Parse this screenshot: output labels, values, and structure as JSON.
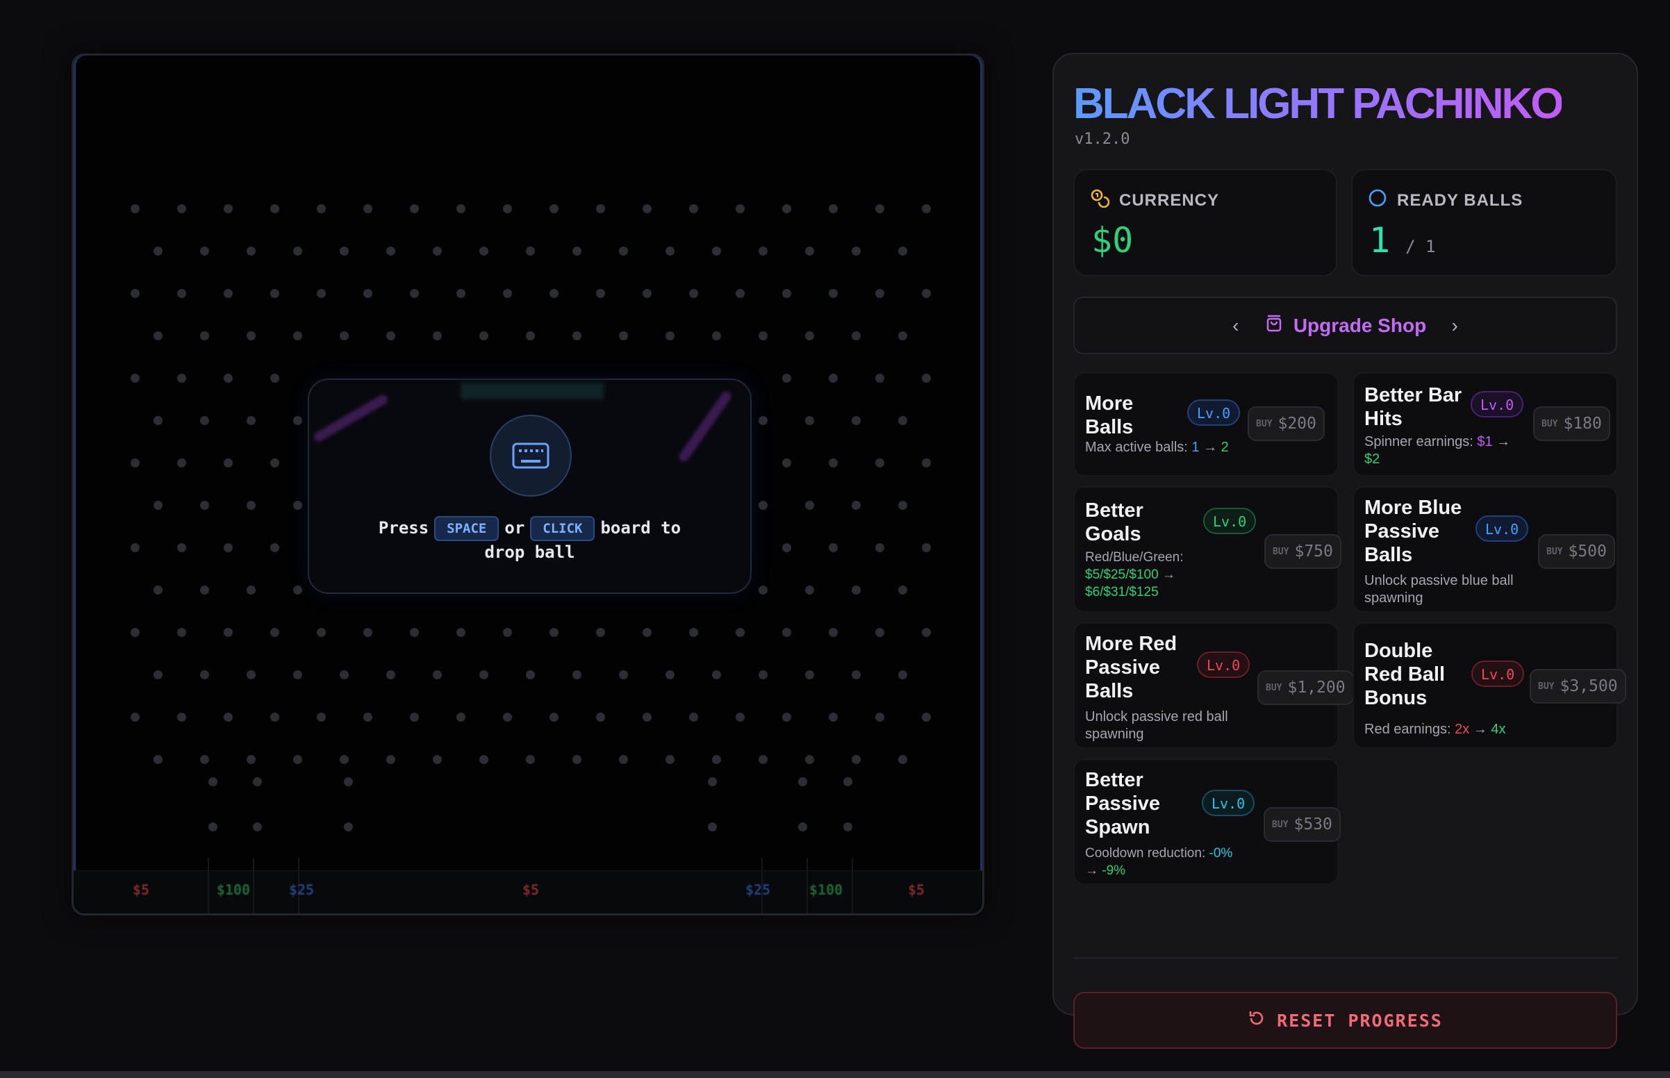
{
  "board": {
    "slots": [
      {
        "label": "$5",
        "color": "#e0444d"
      },
      {
        "label": "$100",
        "color": "#2fb35a"
      },
      {
        "label": "$25",
        "color": "#3a6fd8"
      },
      {
        "label": "$5",
        "color": "#e0444d"
      },
      {
        "label": "$25",
        "color": "#3a6fd8"
      },
      {
        "label": "$100",
        "color": "#2fb35a"
      },
      {
        "label": "$5",
        "color": "#e0444d"
      }
    ],
    "prompt": {
      "press": "Press",
      "key_space": "SPACE",
      "or": "or",
      "key_click": "CLICK",
      "board_to": "board to",
      "drop_ball": "drop ball"
    }
  },
  "panel": {
    "title": "BLACK LIGHT PACHINKO",
    "version": "v1.2.0",
    "currency": {
      "label": "CURRENCY",
      "value": "$0"
    },
    "ready_balls": {
      "label": "READY BALLS",
      "value": "1",
      "max": "/ 1"
    },
    "shop": {
      "title": "Upgrade Shop"
    },
    "upgrades": [
      {
        "name_lines": [
          "More",
          "Balls"
        ],
        "level": "Lv.0",
        "buy_tag": "BUY",
        "price": "$200",
        "desc_pre": "Max active balls: ",
        "from": "1",
        "arrow": " → ",
        "to": "2"
      },
      {
        "name_lines": [
          "Better Bar",
          "Hits"
        ],
        "level": "Lv.0",
        "buy_tag": "BUY",
        "price": "$180",
        "desc_pre": "Spinner earnings: ",
        "from": "$1",
        "arrow": " →",
        "to": "$2"
      },
      {
        "name_lines": [
          "Better",
          "Goals"
        ],
        "level": "Lv.0",
        "buy_tag": "BUY",
        "price": "$750",
        "desc_pre": "Red/Blue/Green:",
        "from": "$5/$25/$100",
        "arrow": " →",
        "to": "$6/$31/$125"
      },
      {
        "name_lines": [
          "More Blue",
          "Passive",
          "Balls"
        ],
        "level": "Lv.0",
        "buy_tag": "BUY",
        "price": "$500",
        "desc_lines": [
          "Unlock passive blue ball",
          "spawning"
        ]
      },
      {
        "name_lines": [
          "More Red",
          "Passive",
          "Balls"
        ],
        "level": "Lv.0",
        "buy_tag": "BUY",
        "price": "$1,200",
        "desc_lines": [
          "Unlock passive red ball",
          "spawning"
        ]
      },
      {
        "name_lines": [
          "Double",
          "Red Ball",
          "Bonus"
        ],
        "level": "Lv.0",
        "buy_tag": "BUY",
        "price": "$3,500",
        "desc_pre": "Red earnings: ",
        "from": "2x",
        "arrow": " → ",
        "to": "4x"
      },
      {
        "name_lines": [
          "Better",
          "Passive",
          "Spawn"
        ],
        "level": "Lv.0",
        "buy_tag": "BUY",
        "price": "$530",
        "desc_pre": "Cooldown reduction: ",
        "from": "-0%",
        "arrow": "→ ",
        "to": "-9%"
      }
    ],
    "reset_label": "RESET PROGRESS"
  }
}
